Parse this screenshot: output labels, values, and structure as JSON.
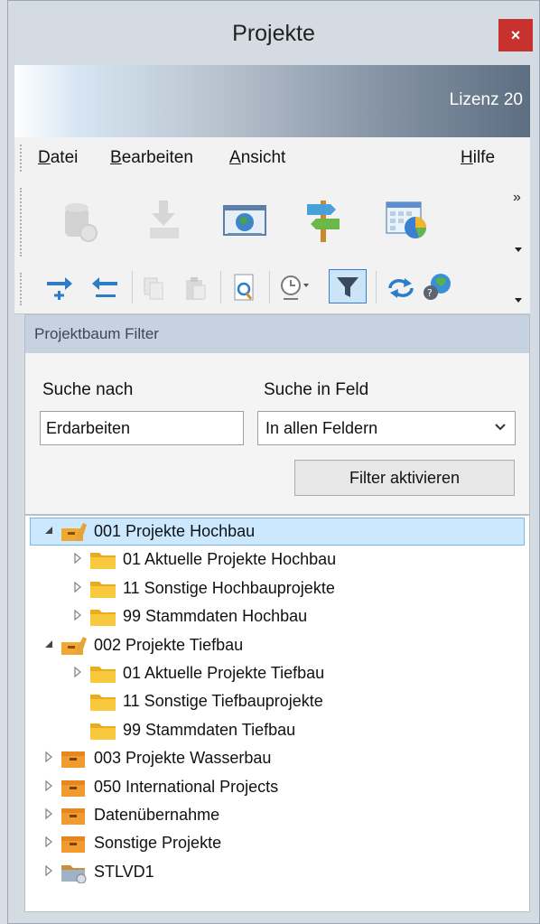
{
  "window": {
    "title": "Projekte",
    "close_label": "×"
  },
  "banner": {
    "license": "Lizenz 20"
  },
  "menu": {
    "items": [
      {
        "ul": "D",
        "rest": "atei"
      },
      {
        "ul": "B",
        "rest": "earbeiten"
      },
      {
        "ul": "A",
        "rest": "nsicht"
      },
      {
        "ul": "H",
        "rest": "ilfe"
      }
    ],
    "overflow": "»"
  },
  "toolbar1": {
    "icons": [
      "database-icon",
      "download-icon",
      "globe-screen-icon",
      "signpost-icon",
      "calendar-chart-icon"
    ]
  },
  "toolbar2": {
    "icons": [
      "add-arrow-icon",
      "remove-arrow-icon",
      "copy-icon",
      "paste-icon",
      "search-page-icon",
      "clock-icon",
      "filter-icon",
      "sync-icon",
      "web-help-icon"
    ]
  },
  "filter": {
    "header": "Projektbaum Filter",
    "search_label": "Suche nach",
    "field_label": "Suche in Feld",
    "search_value": "Erdarbeiten",
    "field_value": "In allen Feldern",
    "button": "Filter aktivieren"
  },
  "tree": {
    "rows": [
      {
        "label": "001 Projekte Hochbau",
        "level": 0,
        "expander": "expanded",
        "icon": "project-folder-open",
        "selected": true
      },
      {
        "label": "01 Aktuelle Projekte Hochbau",
        "level": 1,
        "expander": "collapsed",
        "icon": "folder"
      },
      {
        "label": "11 Sonstige Hochbauprojekte",
        "level": 1,
        "expander": "collapsed",
        "icon": "folder"
      },
      {
        "label": "99 Stammdaten Hochbau",
        "level": 1,
        "expander": "collapsed",
        "icon": "folder"
      },
      {
        "label": "002 Projekte Tiefbau",
        "level": 0,
        "expander": "expanded",
        "icon": "project-folder-open"
      },
      {
        "label": "01 Aktuelle Projekte Tiefbau",
        "level": 1,
        "expander": "collapsed",
        "icon": "folder"
      },
      {
        "label": "11 Sonstige Tiefbauprojekte",
        "level": 1,
        "expander": "none",
        "icon": "folder"
      },
      {
        "label": "99 Stammdaten Tiefbau",
        "level": 1,
        "expander": "none",
        "icon": "folder"
      },
      {
        "label": "003 Projekte Wasserbau",
        "level": 0,
        "expander": "collapsed",
        "icon": "project-box"
      },
      {
        "label": "050 International Projects",
        "level": 0,
        "expander": "collapsed",
        "icon": "project-box"
      },
      {
        "label": "Datenübernahme",
        "level": 0,
        "expander": "collapsed",
        "icon": "project-box"
      },
      {
        "label": "Sonstige Projekte",
        "level": 0,
        "expander": "collapsed",
        "icon": "project-box"
      },
      {
        "label": "STLVD1",
        "level": 0,
        "expander": "collapsed",
        "icon": "network-folder"
      }
    ]
  },
  "colors": {
    "accent": "#3d7fc6",
    "close": "#c7312e",
    "folder": "#f6c232",
    "selection": "#cce8ff"
  }
}
